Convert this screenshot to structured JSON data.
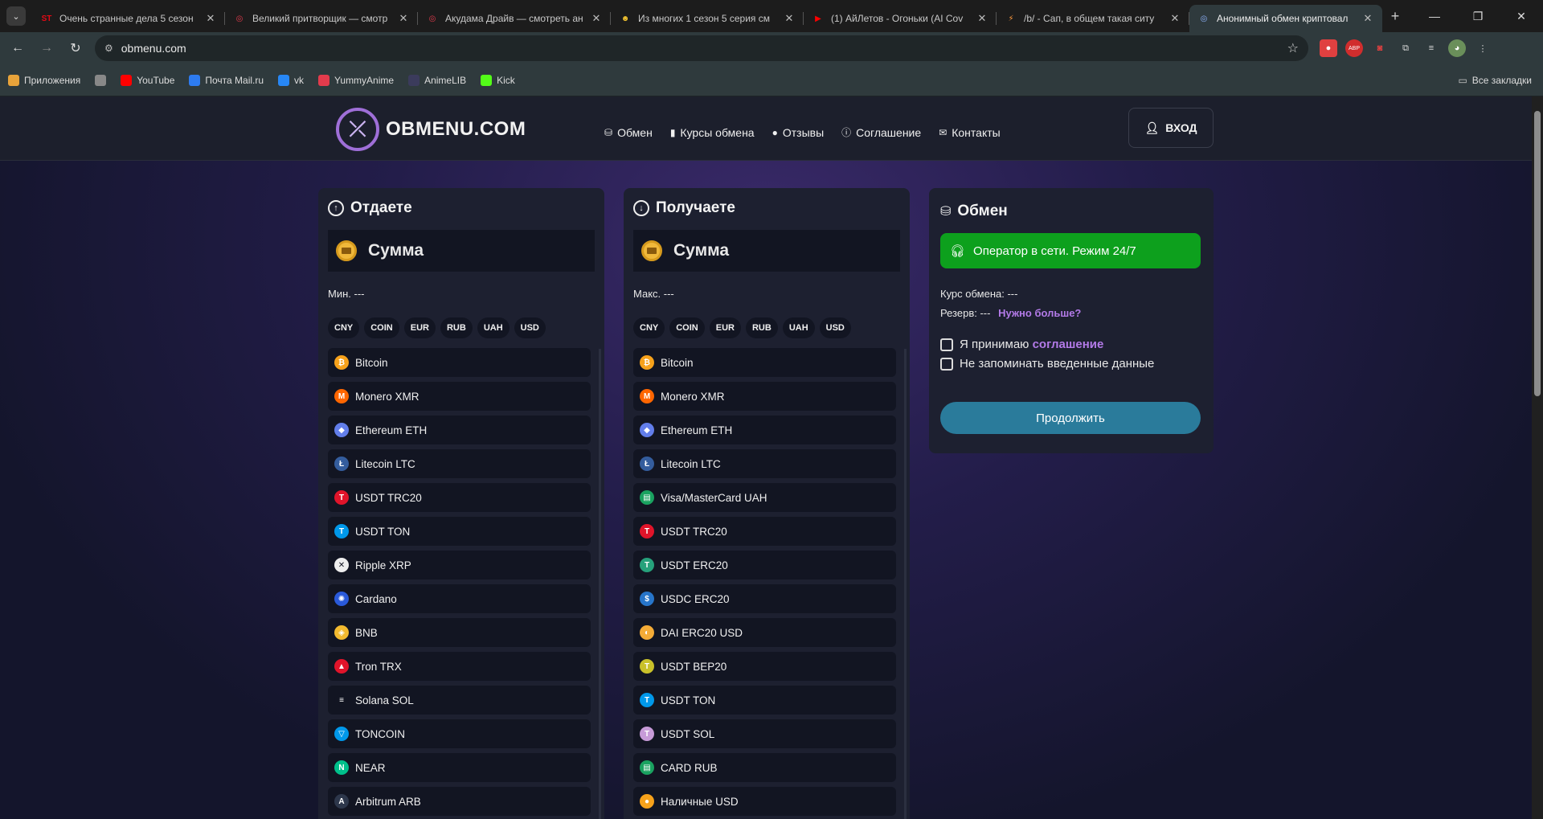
{
  "browser": {
    "tabs": [
      {
        "title": "Очень странные дела 5 сезон",
        "favicon": "ST",
        "color": "#e50914"
      },
      {
        "title": "Великий притворщик — смотр",
        "favicon": "◎",
        "color": "#e33b4c"
      },
      {
        "title": "Акудама Драйв — смотреть ан",
        "favicon": "◎",
        "color": "#e33b4c"
      },
      {
        "title": "Из многих 1 сезон 5 серия см",
        "favicon": "☻",
        "color": "#f4c430"
      },
      {
        "title": "(1) АйЛетов - Огоньки (AI Cov",
        "favicon": "▶",
        "color": "#ff0000"
      },
      {
        "title": "/b/ - Сап, в общем такая ситу",
        "favicon": "⚡",
        "color": "#ff9a3c"
      },
      {
        "title": "Анонимный обмен криптовал",
        "favicon": "◎",
        "color": "#8fb4ff",
        "active": true
      }
    ],
    "url": "obmenu.com",
    "bookmarks": [
      {
        "label": "Приложения",
        "icon": "apps-icon",
        "color": "#e8a33a"
      },
      {
        "label": "",
        "icon": "grid-icon",
        "color": "#888"
      },
      {
        "label": "YouTube",
        "icon": "youtube-icon",
        "color": "#ff0000"
      },
      {
        "label": "Почта Mail.ru",
        "icon": "mail-icon",
        "color": "#2d7bf0"
      },
      {
        "label": "vk",
        "icon": "vk-icon",
        "color": "#2787f5"
      },
      {
        "label": "YummyAnime",
        "icon": "yummy-icon",
        "color": "#e33b4c"
      },
      {
        "label": "AnimeLIB",
        "icon": "animelib-icon",
        "color": "#3b3b5c"
      },
      {
        "label": "Kick",
        "icon": "kick-icon",
        "color": "#53fc18"
      }
    ],
    "all_bookmarks": "Все закладки"
  },
  "site": {
    "logo_text": "OBMENU.COM",
    "nav": [
      {
        "label": "Обмен",
        "icon": "coins-icon"
      },
      {
        "label": "Курсы обмена",
        "icon": "bar-chart-icon"
      },
      {
        "label": "Отзывы",
        "icon": "chat-icon"
      },
      {
        "label": "Соглашение",
        "icon": "info-icon"
      },
      {
        "label": "Контакты",
        "icon": "envelope-icon"
      }
    ],
    "login": "ВХОД"
  },
  "give": {
    "title": "Отдаете",
    "sum_label": "Сумма",
    "limit": "Мин. ---",
    "filters": [
      "CNY",
      "COIN",
      "EUR",
      "RUB",
      "UAH",
      "USD"
    ],
    "items": [
      {
        "name": "Bitcoin",
        "color": "#f7a21b",
        "glyph": "₿"
      },
      {
        "name": "Monero XMR",
        "color": "#ff6600",
        "glyph": "M"
      },
      {
        "name": "Ethereum ETH",
        "color": "#627eea",
        "glyph": "◆"
      },
      {
        "name": "Litecoin LTC",
        "color": "#345d9d",
        "glyph": "Ł"
      },
      {
        "name": "USDT TRC20",
        "color": "#e0142a",
        "glyph": "T"
      },
      {
        "name": "USDT TON",
        "color": "#0098ea",
        "glyph": "T"
      },
      {
        "name": "Ripple XRP",
        "color": "#eeeeee",
        "glyph": "✕"
      },
      {
        "name": "Cardano",
        "color": "#2a5ada",
        "glyph": "✺"
      },
      {
        "name": "BNB",
        "color": "#f3ba2f",
        "glyph": "◈"
      },
      {
        "name": "Tron TRX",
        "color": "#e0142a",
        "glyph": "▲"
      },
      {
        "name": "Solana SOL",
        "color": "#121522",
        "glyph": "≡"
      },
      {
        "name": "TONCOIN",
        "color": "#0098ea",
        "glyph": "▽"
      },
      {
        "name": "NEAR",
        "color": "#00c08b",
        "glyph": "N"
      },
      {
        "name": "Arbitrum ARB",
        "color": "#2d374b",
        "glyph": "A"
      }
    ]
  },
  "get": {
    "title": "Получаете",
    "sum_label": "Сумма",
    "limit": "Макс. ---",
    "filters": [
      "CNY",
      "COIN",
      "EUR",
      "RUB",
      "UAH",
      "USD"
    ],
    "items": [
      {
        "name": "Bitcoin",
        "color": "#f7a21b",
        "glyph": "₿"
      },
      {
        "name": "Monero XMR",
        "color": "#ff6600",
        "glyph": "M"
      },
      {
        "name": "Ethereum ETH",
        "color": "#627eea",
        "glyph": "◆"
      },
      {
        "name": "Litecoin LTC",
        "color": "#345d9d",
        "glyph": "Ł"
      },
      {
        "name": "Visa/MasterCard UAH",
        "color": "#1aa260",
        "glyph": "▤"
      },
      {
        "name": "USDT TRC20",
        "color": "#e0142a",
        "glyph": "T"
      },
      {
        "name": "USDT ERC20",
        "color": "#26a17b",
        "glyph": "T"
      },
      {
        "name": "USDC ERC20",
        "color": "#2775ca",
        "glyph": "$"
      },
      {
        "name": "DAI ERC20 USD",
        "color": "#f5ac37",
        "glyph": "◐"
      },
      {
        "name": "USDT BEP20",
        "color": "#c9c12a",
        "glyph": "T"
      },
      {
        "name": "USDT TON",
        "color": "#0098ea",
        "glyph": "T"
      },
      {
        "name": "USDT SOL",
        "color": "#c79bd8",
        "glyph": "T"
      },
      {
        "name": "CARD RUB",
        "color": "#1aa260",
        "glyph": "▤"
      },
      {
        "name": "Наличные USD",
        "color": "#f7a21b",
        "glyph": "●"
      }
    ]
  },
  "exchange": {
    "title": "Обмен",
    "operator": "Оператор в сети. Режим 24/7",
    "rate": "Курс обмена: ---",
    "reserve": "Резерв: ---",
    "reserve_more": "Нужно больше?",
    "accept_prefix": "Я принимаю",
    "accept_link": "соглашение",
    "no_remember": "Не запоминать введенные данные",
    "continue": "Продолжить"
  }
}
